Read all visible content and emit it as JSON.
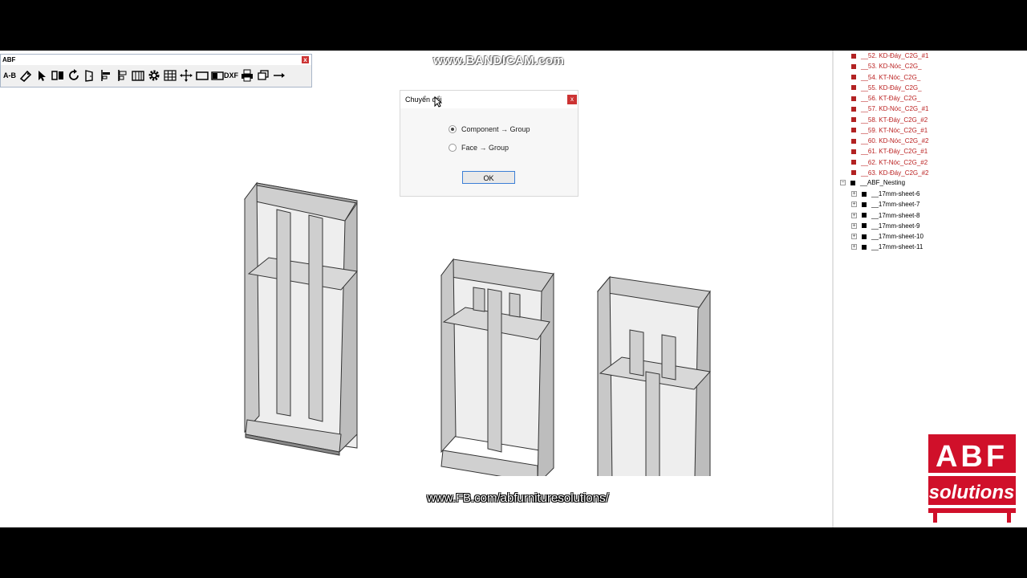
{
  "watermark": {
    "recorder": "www.BANDICAM.com",
    "facebook_url": "www.FB.com/abfurnituresolutions/"
  },
  "toolbar": {
    "title": "ABF",
    "close": "x",
    "ab_label": "A-B",
    "dxf_label": "DXF",
    "icons": [
      "ab-tag-icon",
      "pencil-tag-icon",
      "select-arrow-icon",
      "flip-icon",
      "rotate-icon",
      "door-icon",
      "align-left-icon",
      "align-center-icon",
      "panel-icon",
      "gear-icon",
      "grid-icon",
      "move-icon",
      "rectangle-icon",
      "dxf-export-icon",
      "print-icon",
      "layers-icon",
      "arrow-right-icon"
    ]
  },
  "dialog": {
    "title": "Chuyển đổi",
    "close": "x",
    "options": [
      {
        "label": "Component → Group",
        "checked": true
      },
      {
        "label": "Face → Group",
        "checked": false
      }
    ],
    "ok_label": "OK"
  },
  "outliner": {
    "red_items": [
      "__52. KD-Đáy_C2G_#1",
      "__53. KD-Nóc_C2G_",
      "__54. KT-Nóc_C2G_",
      "__55. KD-Đáy_C2G_",
      "__56. KT-Đáy_C2G_",
      "__57. KD-Nóc_C2G_#1",
      "__58. KT-Đáy_C2G_#2",
      "__59. KT-Nóc_C2G_#1",
      "__60. KD-Nóc_C2G_#2",
      "__61. KT-Đáy_C2G_#1",
      "__62. KT-Nóc_C2G_#2",
      "__63. KD-Đáy_C2G_#2"
    ],
    "group": {
      "label": "__ABF_Nesting",
      "expander": "−"
    },
    "sheets": [
      "__17mm-sheet-6",
      "__17mm-sheet-7",
      "__17mm-sheet-8",
      "__17mm-sheet-9",
      "__17mm-sheet-10",
      "__17mm-sheet-11"
    ],
    "sheet_expander": "+",
    "colors": {
      "red": "#b22222",
      "black": "#000000"
    }
  },
  "logo": {
    "top": "ABF",
    "bottom": "solutions",
    "color": "#d0102a"
  }
}
